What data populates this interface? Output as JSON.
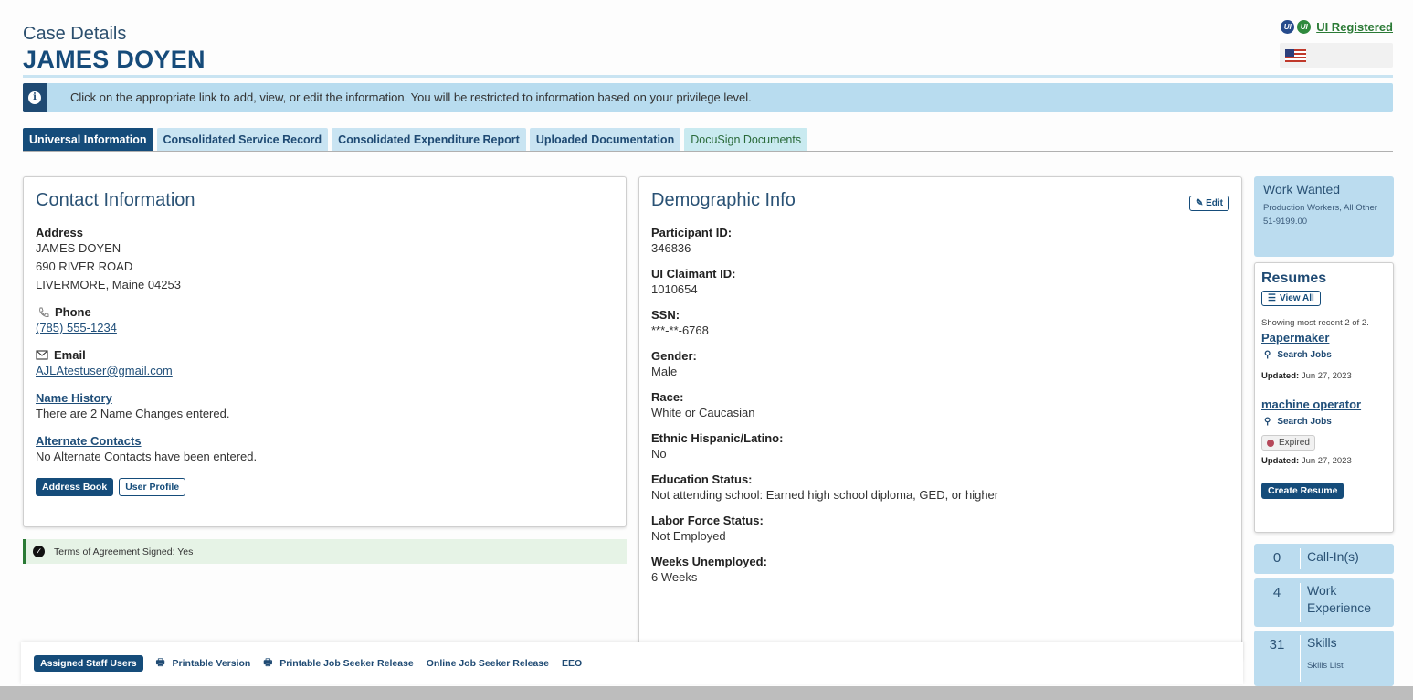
{
  "header": {
    "subtitle": "Case Details",
    "name": "JAMES DOYEN",
    "ui_registered": "UI Registered",
    "ui_badge_1": "UI",
    "ui_badge_2": "UI"
  },
  "info_message": "Click on the appropriate link to add, view, or edit the information. You will be restricted to information based on your privilege level.",
  "tabs": [
    {
      "label": "Universal Information",
      "active": true
    },
    {
      "label": "Consolidated Service Record"
    },
    {
      "label": "Consolidated Expenditure Report"
    },
    {
      "label": "Uploaded Documentation"
    },
    {
      "label": "DocuSign Documents"
    }
  ],
  "contact": {
    "title": "Contact Information",
    "address_label": "Address",
    "address_lines": [
      "JAMES DOYEN",
      "690 RIVER ROAD",
      "LIVERMORE, Maine 04253"
    ],
    "phone_label": "Phone",
    "phone": "(785) 555-1234",
    "email_label": "Email",
    "email": "AJLAtestuser@gmail.com",
    "name_history_label": "Name History",
    "name_history_text": "There are 2 Name Changes entered.",
    "alt_contacts_label": "Alternate Contacts",
    "alt_contacts_text": "No Alternate Contacts have been entered.",
    "address_book_btn": "Address Book",
    "user_profile_btn": "User Profile"
  },
  "terms": "Terms of Agreement Signed: Yes",
  "demographic": {
    "title": "Demographic Info",
    "edit_label": "Edit",
    "fields": [
      {
        "label": "Participant ID:",
        "value": "346836"
      },
      {
        "label": "UI Claimant ID:",
        "value": "1010654"
      },
      {
        "label": "SSN:",
        "value": "***-**-6768"
      },
      {
        "label": "Gender:",
        "value": "Male"
      },
      {
        "label": "Race:",
        "value": "White or Caucasian"
      },
      {
        "label": "Ethnic Hispanic/Latino:",
        "value": "No"
      },
      {
        "label": "Education Status:",
        "value": "Not attending school: Earned high school diploma, GED, or higher"
      },
      {
        "label": "Labor Force Status:",
        "value": "Not Employed"
      },
      {
        "label": "Weeks Unemployed:",
        "value": "6 Weeks"
      }
    ]
  },
  "work_wanted": {
    "title": "Work Wanted",
    "occupation": "Production Workers, All Other",
    "code": "51-9199.00"
  },
  "resumes": {
    "title": "Resumes",
    "view_all": "View All",
    "showing": "Showing most recent 2 of 2.",
    "items": [
      {
        "title": "Papermaker",
        "search": "Search Jobs",
        "updated_label": "Updated:",
        "updated": "Jun 27, 2023"
      },
      {
        "title": "machine operator",
        "search": "Search Jobs",
        "status": "Expired",
        "updated_label": "Updated:",
        "updated": "Jun 27, 2023"
      }
    ],
    "create": "Create Resume"
  },
  "stats": [
    {
      "count": "0",
      "label": "Call-In(s)"
    },
    {
      "count": "4",
      "label": "Work Experience"
    },
    {
      "count": "31",
      "label": "Skills",
      "sub": "Skills List"
    }
  ],
  "footer": {
    "assigned": "Assigned Staff Users",
    "printable": "Printable Version",
    "printable_release": "Printable Job Seeker Release",
    "online_release": "Online Job Seeker Release",
    "eeo": "EEO"
  }
}
